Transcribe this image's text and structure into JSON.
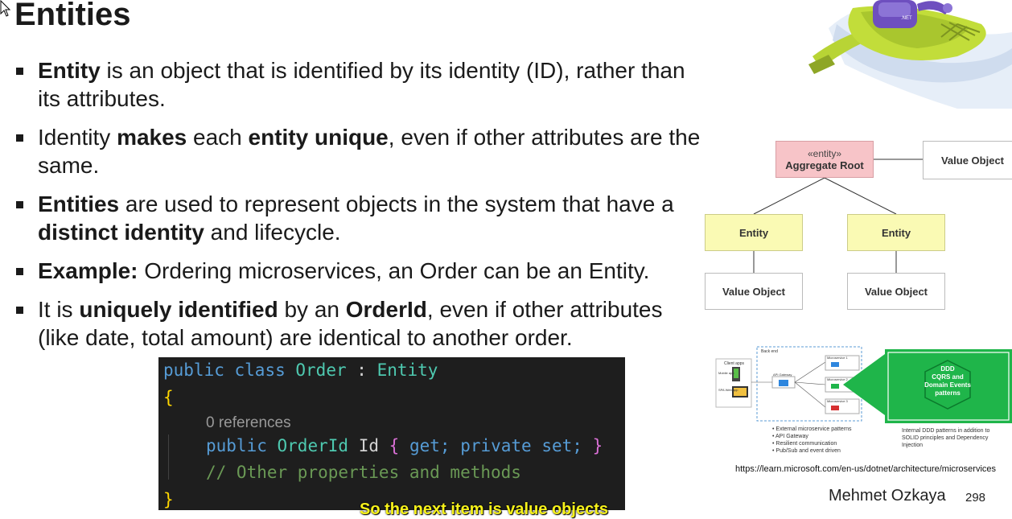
{
  "title": "Entities",
  "bullets": [
    {
      "parts": [
        {
          "text": "Entity",
          "bold": true
        },
        {
          "text": " is an object that is identified by its identity (ID), rather than its attributes.",
          "bold": false
        }
      ]
    },
    {
      "parts": [
        {
          "text": "Identity ",
          "bold": false
        },
        {
          "text": "makes",
          "bold": true
        },
        {
          "text": " each ",
          "bold": false
        },
        {
          "text": "entity unique",
          "bold": true
        },
        {
          "text": ", even if other attributes are the same.",
          "bold": false
        }
      ]
    },
    {
      "parts": [
        {
          "text": "Entities",
          "bold": true
        },
        {
          "text": " are used to represent objects in the system that have a ",
          "bold": false
        },
        {
          "text": "distinct identity",
          "bold": true
        },
        {
          "text": " and lifecycle.",
          "bold": false
        }
      ]
    },
    {
      "parts": [
        {
          "text": "Example:",
          "bold": true
        },
        {
          "text": " Ordering microservices, an Order can be an Entity.",
          "bold": false
        }
      ]
    },
    {
      "parts": [
        {
          "text": "It is ",
          "bold": false
        },
        {
          "text": "uniquely identified",
          "bold": true
        },
        {
          "text": " by an ",
          "bold": false
        },
        {
          "text": "OrderId",
          "bold": true
        },
        {
          "text": ", even if other attributes (like date, total amount) are identical to another order.",
          "bold": false
        }
      ]
    }
  ],
  "diagram": {
    "aggregate_stereotype": "«entity»",
    "aggregate_root": "Aggregate Root",
    "value_object": "Value Object",
    "entity": "Entity"
  },
  "ms_diagram": {
    "client_apps": "Client apps",
    "back_end": "Back end",
    "api_gateway": "API Gateway",
    "microservice_1": "Microservice 1",
    "microservice_2": "Microservice 2",
    "microservice_3": "Microservice 3",
    "mobile_app": "Mobile app",
    "spa_web_app": "SPA Web app",
    "ddd_badge": "DDD\nCQRS and\nDomain Events\npatterns",
    "external_list": [
      "External microservice patterns",
      "API Gateway",
      "Resilient communication",
      "Pub/Sub and event driven"
    ],
    "internal_text": "Internal DDD patterns in addition to SOLID principles and Dependency Injection"
  },
  "url": "https://learn.microsoft.com/en-us/dotnet/architecture/microservices",
  "author": "Mehmet Ozkaya",
  "page_number": "298",
  "code": {
    "public": "public",
    "class": "class",
    "class_name": "Order",
    "colon": ":",
    "base": "Entity",
    "open_brace": "{",
    "references": "0 references",
    "id_type": "OrderId",
    "id_name": "Id",
    "prop_open": "{",
    "get": "get;",
    "private": "private",
    "set": "set;",
    "prop_close": "}",
    "comment": "// Other properties and methods",
    "close_brace": "}"
  },
  "subtitle": "So the next item is value objects",
  "colors": {
    "aggregate_fill": "#f7c4c8",
    "entity_fill": "#fafab4",
    "ddd_green": "#1fb54a",
    "code_bg": "#1e1e1e",
    "subtitle_yellow": "#f7f21a"
  }
}
